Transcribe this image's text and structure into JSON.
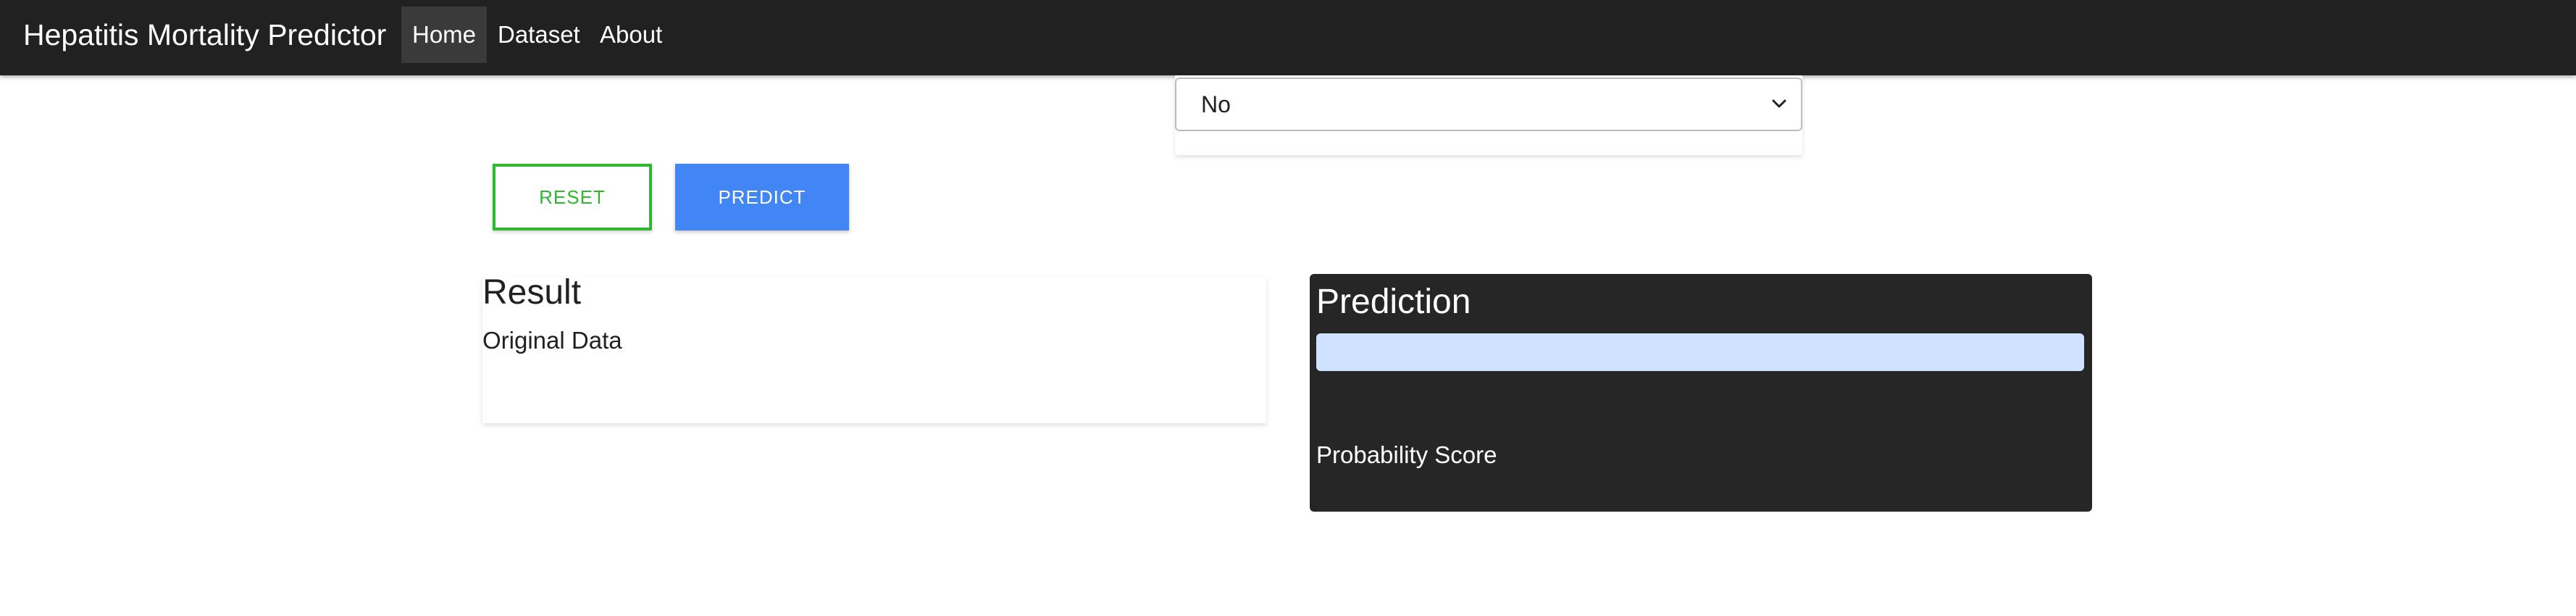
{
  "navbar": {
    "brand": "Hepatitis Mortality Predictor",
    "links": [
      {
        "label": "Home",
        "active": true
      },
      {
        "label": "Dataset",
        "active": false
      },
      {
        "label": "About",
        "active": false
      }
    ]
  },
  "form": {
    "select_value": "No"
  },
  "actions": {
    "reset_label": "Reset",
    "predict_label": "Predict"
  },
  "result": {
    "title": "Result",
    "subtitle": "Original Data"
  },
  "prediction": {
    "title": "Prediction",
    "probability_label": "Probability Score"
  },
  "colors": {
    "navbar_bg": "#212121",
    "reset_accent": "#2eb82e",
    "predict_bg": "#4285f4",
    "prediction_card_bg": "#262626",
    "prediction_bar": "#cfe2ff"
  },
  "icons": {
    "select_chevron": "chevron-down-icon"
  }
}
